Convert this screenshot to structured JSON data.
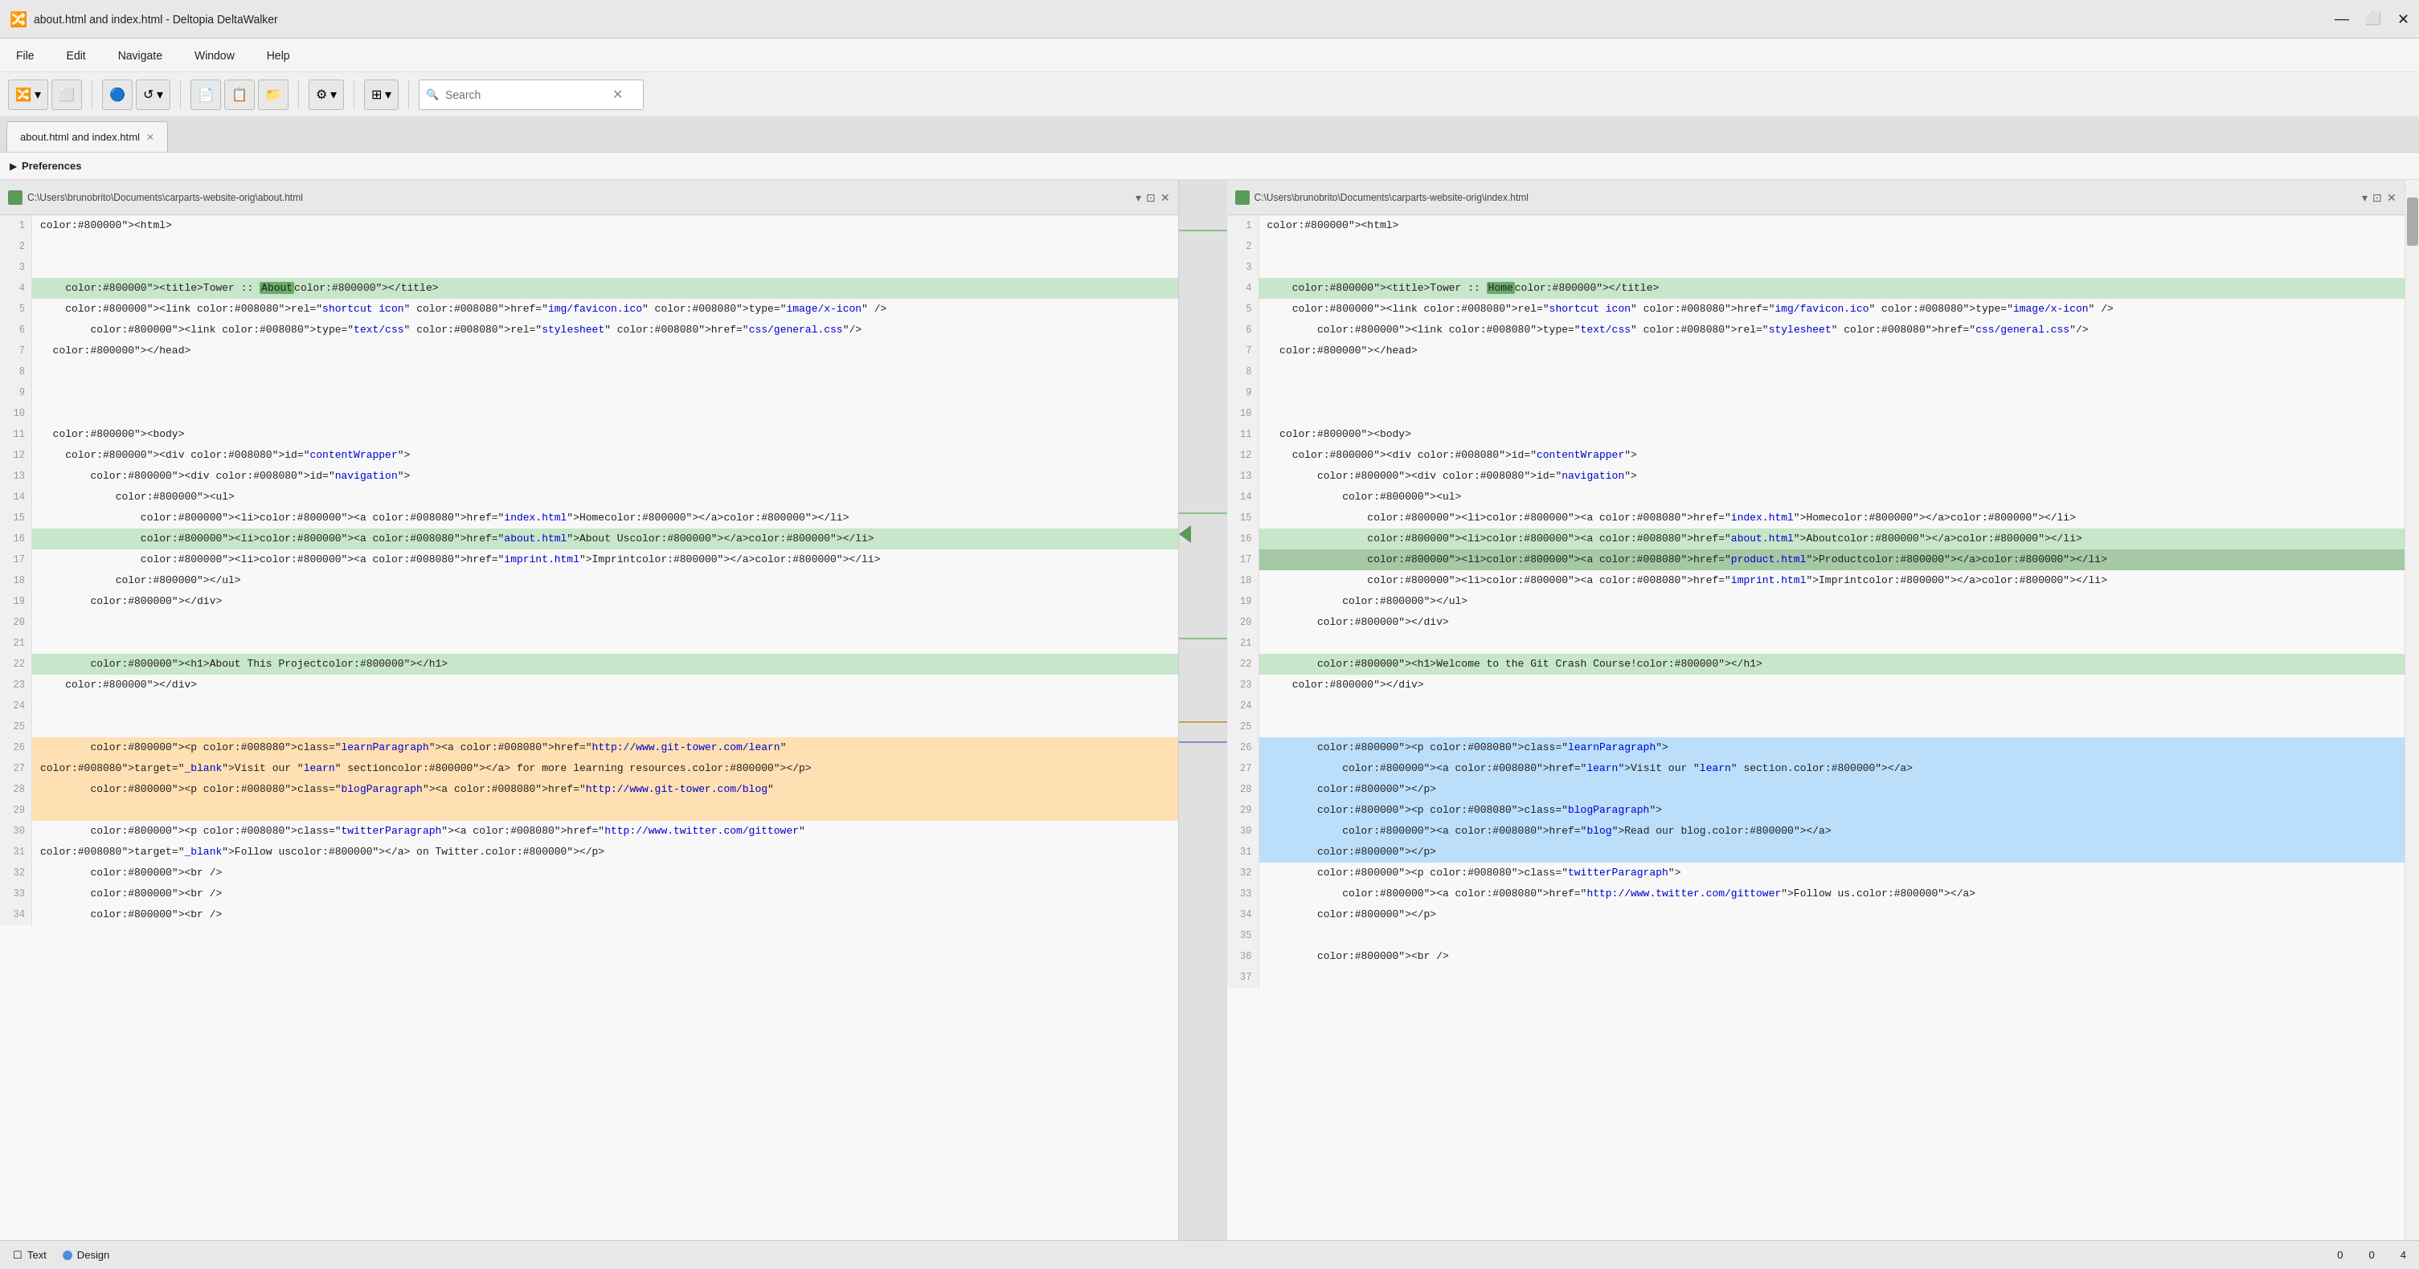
{
  "titleBar": {
    "title": "about.html and index.html - Deltopia DeltaWalker",
    "icon": "🔀"
  },
  "menuBar": {
    "items": [
      "File",
      "Edit",
      "Navigate",
      "Window",
      "Help"
    ]
  },
  "toolbar": {
    "searchPlaceholder": "Search",
    "searchLabel": "Search"
  },
  "tabs": [
    {
      "label": "about.html and index.html",
      "active": true
    }
  ],
  "preferences": {
    "label": "Preferences"
  },
  "leftPanel": {
    "path": "C:\\Users\\brunobrito\\Documents\\carparts-website-orig\\about.html",
    "lines": [
      {
        "num": 1,
        "code": "<html>",
        "hl": ""
      },
      {
        "num": 2,
        "code": "",
        "hl": ""
      },
      {
        "num": 3,
        "code": "",
        "hl": ""
      },
      {
        "num": 4,
        "code": "    <title>Tower :: About</title>",
        "hl": "green"
      },
      {
        "num": 5,
        "code": "    <link rel=\"shortcut icon\" href=\"img/favicon.ico\" type=\"image/x-icon\" />",
        "hl": ""
      },
      {
        "num": 6,
        "code": "        <link type=\"text/css\" rel=\"stylesheet\" href=\"css/general.css\"/>",
        "hl": ""
      },
      {
        "num": 7,
        "code": "  </head>",
        "hl": ""
      },
      {
        "num": 8,
        "code": "",
        "hl": ""
      },
      {
        "num": 9,
        "code": "",
        "hl": ""
      },
      {
        "num": 10,
        "code": "",
        "hl": ""
      },
      {
        "num": 11,
        "code": "  <body>",
        "hl": ""
      },
      {
        "num": 12,
        "code": "    <div id=\"contentWrapper\">",
        "hl": ""
      },
      {
        "num": 13,
        "code": "        <div id=\"navigation\">",
        "hl": ""
      },
      {
        "num": 14,
        "code": "            <ul>",
        "hl": ""
      },
      {
        "num": 15,
        "code": "                <li><a href=\"index.html\">Home</a></li>",
        "hl": ""
      },
      {
        "num": 16,
        "code": "                <li><a href=\"about.html\">About Us</a></li>",
        "hl": "green"
      },
      {
        "num": 17,
        "code": "                <li><a href=\"imprint.html\">Imprint</a></li>",
        "hl": ""
      },
      {
        "num": 18,
        "code": "            </ul>",
        "hl": ""
      },
      {
        "num": 19,
        "code": "        </div>",
        "hl": ""
      },
      {
        "num": 20,
        "code": "",
        "hl": ""
      },
      {
        "num": 21,
        "code": "",
        "hl": ""
      },
      {
        "num": 22,
        "code": "        <h1>About This Project</h1>",
        "hl": "green"
      },
      {
        "num": 23,
        "code": "    </div>",
        "hl": ""
      },
      {
        "num": 24,
        "code": "",
        "hl": ""
      },
      {
        "num": 25,
        "code": "",
        "hl": ""
      },
      {
        "num": 26,
        "code": "        <p class=\"learnParagraph\"><a href=\"http://www.git-tower.com/learn\"",
        "hl": "orange"
      },
      {
        "num": 27,
        "code": "target=\"_blank\">Visit our \"learn\" section</a> for more learning resources.</p>",
        "hl": "orange"
      },
      {
        "num": 28,
        "code": "        <p class=\"blogParagraph\"><a href=\"http://www.git-tower.com/blog\"",
        "hl": "orange"
      },
      {
        "num": 29,
        "code": "",
        "hl": "orange"
      },
      {
        "num": 30,
        "code": "        <p class=\"twitterParagraph\"><a href=\"http://www.twitter.com/gittower\"",
        "hl": ""
      },
      {
        "num": 31,
        "code": "target=\"_blank\">Follow us</a> on Twitter.</p>",
        "hl": ""
      },
      {
        "num": 32,
        "code": "        <br />",
        "hl": ""
      },
      {
        "num": 33,
        "code": "        <br />",
        "hl": ""
      },
      {
        "num": 34,
        "code": "        <br />",
        "hl": ""
      }
    ]
  },
  "rightPanel": {
    "path": "C:\\Users\\brunobrito\\Documents\\carparts-website-orig\\index.html",
    "lines": [
      {
        "num": 1,
        "code": "<html>",
        "hl": ""
      },
      {
        "num": 2,
        "code": "",
        "hl": ""
      },
      {
        "num": 3,
        "code": "",
        "hl": ""
      },
      {
        "num": 4,
        "code": "    <title>Tower :: Home</title>",
        "hl": "green"
      },
      {
        "num": 5,
        "code": "    <link rel=\"shortcut icon\" href=\"img/favicon.ico\" type=\"image/x-icon\" />",
        "hl": ""
      },
      {
        "num": 6,
        "code": "        <link type=\"text/css\" rel=\"stylesheet\" href=\"css/general.css\"/>",
        "hl": ""
      },
      {
        "num": 7,
        "code": "  </head>",
        "hl": ""
      },
      {
        "num": 8,
        "code": "",
        "hl": ""
      },
      {
        "num": 9,
        "code": "",
        "hl": ""
      },
      {
        "num": 10,
        "code": "",
        "hl": ""
      },
      {
        "num": 11,
        "code": "  <body>",
        "hl": ""
      },
      {
        "num": 12,
        "code": "    <div id=\"contentWrapper\">",
        "hl": ""
      },
      {
        "num": 13,
        "code": "        <div id=\"navigation\">",
        "hl": ""
      },
      {
        "num": 14,
        "code": "            <ul>",
        "hl": ""
      },
      {
        "num": 15,
        "code": "                <li><a href=\"index.html\">Home</a></li>",
        "hl": ""
      },
      {
        "num": 16,
        "code": "                <li><a href=\"about.html\">About</a></li>",
        "hl": "green"
      },
      {
        "num": 17,
        "code": "                <li><a href=\"product.html\">Product</a></li>",
        "hl": "green-dark"
      },
      {
        "num": 18,
        "code": "                <li><a href=\"imprint.html\">Imprint</a></li>",
        "hl": ""
      },
      {
        "num": 19,
        "code": "            </ul>",
        "hl": ""
      },
      {
        "num": 20,
        "code": "        </div>",
        "hl": ""
      },
      {
        "num": 21,
        "code": "",
        "hl": ""
      },
      {
        "num": 22,
        "code": "        <h1>Welcome to the Git Crash Course!</h1>",
        "hl": "green"
      },
      {
        "num": 23,
        "code": "    </div>",
        "hl": ""
      },
      {
        "num": 24,
        "code": "",
        "hl": ""
      },
      {
        "num": 25,
        "code": "",
        "hl": ""
      },
      {
        "num": 26,
        "code": "        <p class=\"learnParagraph\">",
        "hl": "blue"
      },
      {
        "num": 27,
        "code": "            <a href=\"learn\">Visit our \"learn\" section.</a>",
        "hl": "blue"
      },
      {
        "num": 28,
        "code": "        </p>",
        "hl": "blue"
      },
      {
        "num": 29,
        "code": "        <p class=\"blogParagraph\">",
        "hl": "blue"
      },
      {
        "num": 30,
        "code": "            <a href=\"blog\">Read our blog.</a>",
        "hl": "blue"
      },
      {
        "num": 31,
        "code": "        </p>",
        "hl": "blue"
      },
      {
        "num": 32,
        "code": "        <p class=\"twitterParagraph\">",
        "hl": ""
      },
      {
        "num": 33,
        "code": "            <a href=\"http://www.twitter.com/gittower\">Follow us.</a>",
        "hl": ""
      },
      {
        "num": 34,
        "code": "        </p>",
        "hl": ""
      },
      {
        "num": 35,
        "code": "",
        "hl": ""
      },
      {
        "num": 36,
        "code": "        <br />",
        "hl": ""
      },
      {
        "num": 37,
        "code": "",
        "hl": ""
      }
    ]
  },
  "statusBar": {
    "textLabel": "Text",
    "designLabel": "Design",
    "leftCount": "0",
    "middleCount": "0",
    "rightCount": "4"
  }
}
